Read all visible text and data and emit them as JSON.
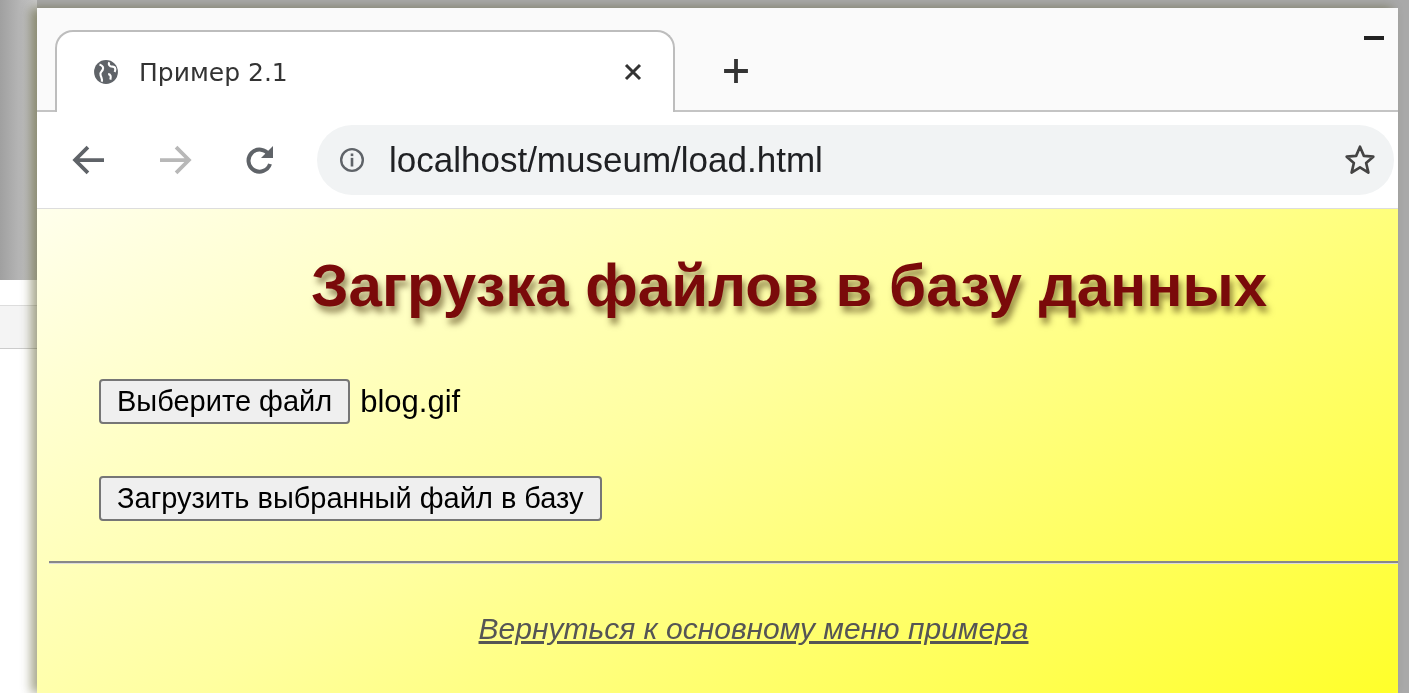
{
  "tab": {
    "title": "Пример 2.1"
  },
  "nav": [
    {
      "kind": "back",
      "disabled": false
    },
    {
      "kind": "forward",
      "disabled": true
    },
    {
      "kind": "reload",
      "disabled": false
    }
  ],
  "address": {
    "url": "localhost/museum/load.html"
  },
  "page": {
    "heading": "Загрузка файлов в базу данных",
    "file_input": {
      "button": "Выберите файл",
      "file_name": "blog.gif"
    },
    "upload_button": "Загрузить выбранный файл в базу",
    "link": "Вернуться к основному меню примера"
  }
}
